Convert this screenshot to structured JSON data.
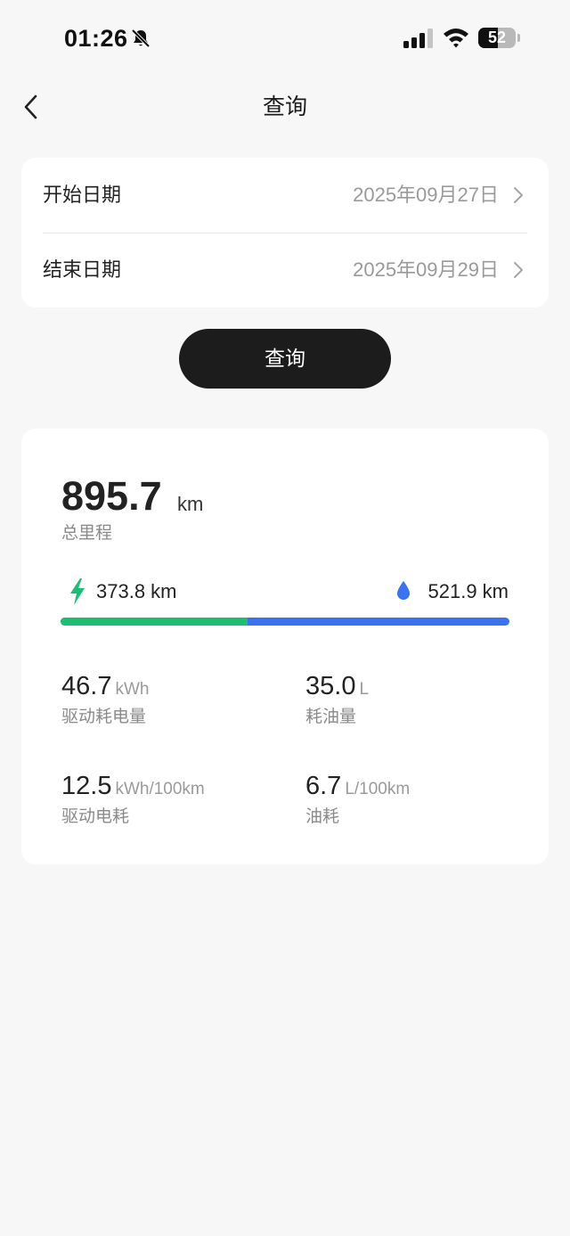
{
  "status_bar": {
    "time": "01:26",
    "battery_percent": "52",
    "battery_level": 0.52,
    "icons": [
      "bell-slash-icon",
      "signal-icon",
      "wifi-icon",
      "battery-icon"
    ]
  },
  "nav": {
    "back_icon": "chevron-left-icon",
    "title": "查询"
  },
  "date_range": {
    "start": {
      "label": "开始日期",
      "value": "2025年09月27日"
    },
    "end": {
      "label": "结束日期",
      "value": "2025年09月29日"
    },
    "row_icon": "chevron-right-icon"
  },
  "query_button": {
    "label": "查询"
  },
  "summary": {
    "total_value": "895.7",
    "total_unit": "km",
    "total_label": "总里程",
    "electric": {
      "icon": "lightning-bolt-icon",
      "value": "373.8 km",
      "km": 373.8,
      "color": "#1dbd73"
    },
    "fuel": {
      "icon": "water-drop-icon",
      "value": "521.9 km",
      "km": 521.9,
      "color": "#3a72f0"
    },
    "metrics": [
      {
        "value": "46.7",
        "unit": "kWh",
        "label": "驱动耗电量"
      },
      {
        "value": "35.0",
        "unit": "L",
        "label": "耗油量"
      },
      {
        "value": "12.5",
        "unit": "kWh/100km",
        "label": "驱动电耗"
      },
      {
        "value": "6.7",
        "unit": "L/100km",
        "label": "油耗"
      }
    ]
  },
  "colors": {
    "background": "#f7f7f7",
    "card": "#ffffff",
    "button": "#1c1c1c",
    "electric": "#1dbd73",
    "fuel": "#3a72f0"
  }
}
